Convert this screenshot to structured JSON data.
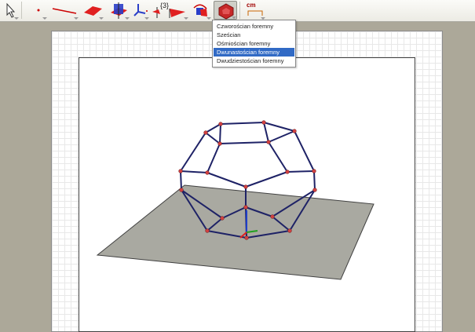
{
  "toolbar": {
    "tools": [
      {
        "name": "select-pointer-tool",
        "icon": "arrow-pointer-icon"
      },
      {
        "name": "point-tool",
        "icon": "point-icon"
      },
      {
        "name": "line-tool",
        "icon": "line-segment-icon"
      },
      {
        "name": "plane-tool",
        "icon": "plane-icon"
      },
      {
        "name": "perpendicular-plane-tool",
        "icon": "perpendicular-plane-icon"
      },
      {
        "name": "axes-tool",
        "icon": "axes-icon"
      },
      {
        "name": "regular-polygon-tool",
        "icon": "regular-polygon-icon",
        "label": "{3}"
      },
      {
        "name": "pyramid-tool",
        "icon": "pyramid-icon"
      },
      {
        "name": "rotate-tool",
        "icon": "rotate-icon"
      },
      {
        "name": "regular-polyhedron-tool",
        "icon": "polyhedron-icon"
      },
      {
        "name": "measure-tool",
        "icon": "ruler-icon",
        "label": "cm"
      }
    ]
  },
  "polyhedron_menu": {
    "items": [
      {
        "label": "Czworościan foremny",
        "selected": false
      },
      {
        "label": "Sześcian",
        "selected": false
      },
      {
        "label": "Ośmiościan foremny",
        "selected": false
      },
      {
        "label": "Dwunastościan foremny",
        "selected": true
      },
      {
        "label": "Dwudziestościan foremny",
        "selected": false
      }
    ]
  },
  "colors": {
    "accent": "#316ac5",
    "edge": "#1e2266",
    "vertex": "#d04040",
    "plane": "#a8a8a0"
  }
}
